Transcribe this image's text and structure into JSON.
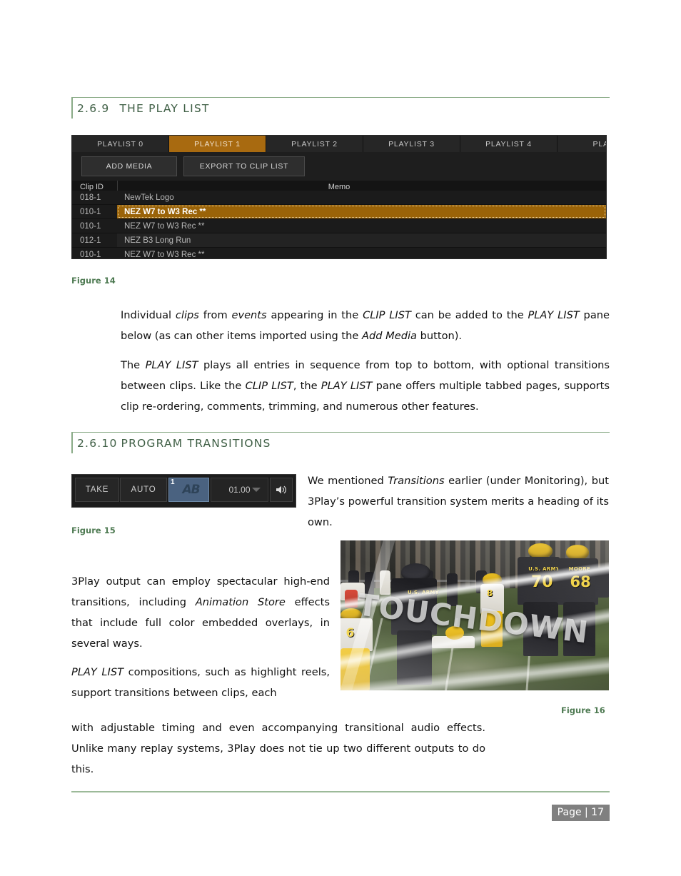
{
  "document": {
    "page_label": "Page | 17"
  },
  "sections": [
    {
      "number": "2.6.9",
      "title": "THE PLAY LIST"
    },
    {
      "number": "2.6.10",
      "title": "PROGRAM TRANSITIONS"
    }
  ],
  "figures": {
    "fig14_caption": "Figure 14",
    "fig15_caption": "Figure 15",
    "fig16_caption": "Figure 16"
  },
  "play_list_panel": {
    "tabs": [
      {
        "label": "PLAYLIST 0",
        "active": false
      },
      {
        "label": "PLAYLIST 1",
        "active": true
      },
      {
        "label": "PLAYLIST 2",
        "active": false
      },
      {
        "label": "PLAYLIST 3",
        "active": false
      },
      {
        "label": "PLAYLIST 4",
        "active": false
      },
      {
        "label": "PLAYL",
        "active": false
      }
    ],
    "buttons": {
      "add_media": "ADD MEDIA",
      "export_to_clip_list": "EXPORT TO CLIP LIST"
    },
    "columns": {
      "clip_id": "Clip ID",
      "memo": "Memo"
    },
    "rows": [
      {
        "clip_id": "018-1",
        "memo": "NewTek Logo",
        "selected": false
      },
      {
        "clip_id": "010-1",
        "memo": "NEZ W7 to W3 Rec **",
        "selected": true
      },
      {
        "clip_id": "010-1",
        "memo": "NEZ W7 to W3 Rec **",
        "selected": false
      },
      {
        "clip_id": "012-1",
        "memo": "NEZ B3 Long Run",
        "selected": false
      },
      {
        "clip_id": "010-1",
        "memo": "NEZ W7 to W3 Rec **",
        "selected": false
      }
    ],
    "colors": {
      "accent": "#a86a10",
      "selected_row": "#9a6308",
      "panel_background": "#1e1e1e"
    }
  },
  "transition_toolbar": {
    "take_label": "TAKE",
    "auto_label": "AUTO",
    "transition_badge": "1",
    "transition_icon_label": "AB",
    "duration_value": "01.00",
    "dropdown_icon": "chevron-down-icon",
    "audio_icon": "speaker-icon",
    "audio_glyph": "🔊",
    "colors": {
      "selected_slot": "#4a6280"
    }
  },
  "figure16_image": {
    "overlay_text": "TOUCHDOWN",
    "jersey_numbers": [
      "70",
      "68",
      "6",
      "8"
    ],
    "jersey_texts": [
      "U.S. ARMY",
      "MOORE"
    ],
    "description_alt": "American football play with white transition streaks and TOUCHDOWN overlay"
  },
  "body": {
    "p_individual": {
      "l1a": "Individual ",
      "i1": "clips",
      "l1b": " from ",
      "i2": "events",
      "l1c": " appearing in the ",
      "i3": "CLIP LIST",
      "l1d": " can be added to the ",
      "i4": "PLAY LIST",
      "l1e": " pane below (as can other items imported using the ",
      "i5": "Add Media",
      "l1f": " button)."
    },
    "p_playlist": {
      "a": "The ",
      "i1": "PLAY LIST",
      "b": " plays all entries in sequence from top to bottom, with optional transitions between clips.  Like the ",
      "i2": "CLIP LIST",
      "c": ", the ",
      "i3": "PLAY LIST",
      "d": " pane offers multiple tabbed pages, supports clip re-ordering, comments, trimming, and numerous other features."
    },
    "p_transitions": {
      "a": "We mentioned ",
      "i1": "Transitions",
      "b": " earlier (under Monitoring), but 3Play’s powerful transition system merits a heading of its own."
    },
    "p_3play": {
      "a": "3Play output can employ spectacular high-end transitions, including ",
      "i1": "Animation Store",
      "b": " effects that include full color embedded overlays, in several ways."
    },
    "p_playlistcomp": {
      "i1": "PLAY LIST",
      "a": " compositions, such as highlight reels, support transitions between clips, each"
    },
    "p_wrap": {
      "a": "with adjustable timing and even accompanying transitional audio effects. Unlike many replay systems, 3Play does not tie up two different outputs to do this."
    }
  }
}
